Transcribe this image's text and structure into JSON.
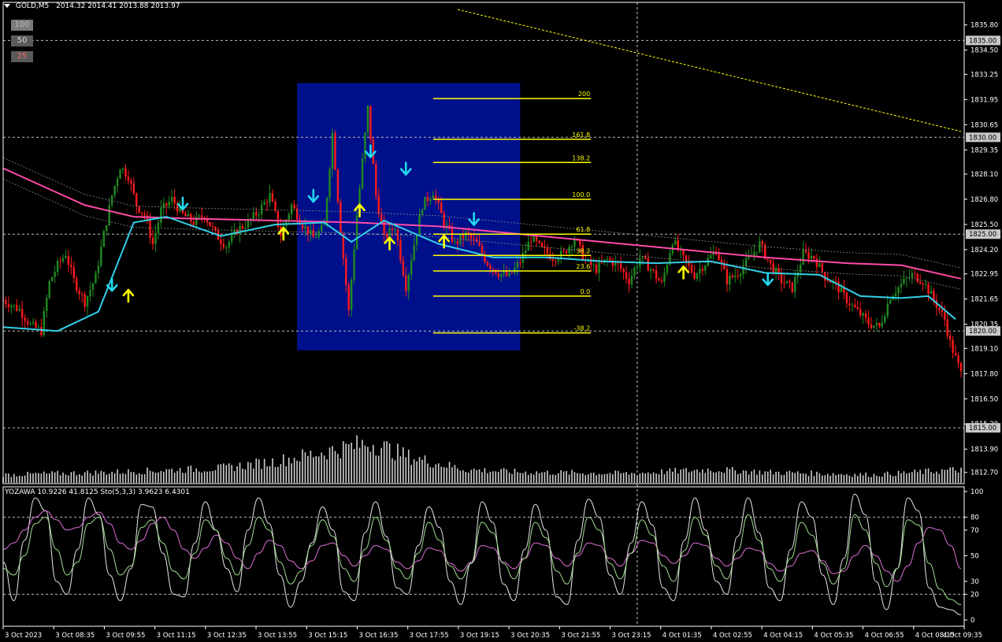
{
  "header": {
    "symbol": "GOLD,M5",
    "ohlc": "2014.32 2014.41 2013.88 2013.97"
  },
  "timeframe_buttons": [
    {
      "label": "100",
      "color": "#bdbdbd",
      "bg": "#7a7a7a"
    },
    {
      "label": "50",
      "color": "#d9d9d9",
      "bg": "#5a5a5a"
    },
    {
      "label": "25",
      "color": "#ff6a6a",
      "bg": "#5a5a5a"
    }
  ],
  "indicator_header": {
    "text": "YOZAWA 10.9226 41.8125  Sto(5,3,3) 3.9623 6.4301"
  },
  "colors": {
    "background": "#000000",
    "bull_bar": "#1f8a1f",
    "bear_bar": "#ff1a1a",
    "ma_fast": "#33d0e8",
    "ma_slow": "#ff4aa8",
    "fib_line": "#ffff00",
    "fib_box": "#00108a",
    "arrow_up": "#ffff00",
    "arrow_down": "#22d8f0",
    "volume": "#d0d0d0",
    "stoch_main": "#e8e8e8",
    "stoch_pink": "#e070d8",
    "stoch_green": "#a0e090",
    "axis": "#ffffff",
    "level_highlight_bg": "#c8c8c8"
  },
  "chart_data": [
    {
      "type": "candlestick",
      "price_axis_ticks": [
        "1835.80",
        "1834.50",
        "1833.25",
        "1831.95",
        "1830.65",
        "1829.35",
        "1828.10",
        "1826.80",
        "1825.50",
        "1824.20",
        "1822.95",
        "1821.65",
        "1820.35",
        "1819.10",
        "1817.80",
        "1816.50",
        "1815.20",
        "1813.90",
        "1812.70"
      ],
      "highlighted_levels": [
        "1835.00",
        "1830.00",
        "1825.00",
        "1820.00",
        "1815.00"
      ],
      "time_axis_ticks": [
        "3 Oct 2023",
        "3 Oct 08:35",
        "3 Oct 09:55",
        "3 Oct 11:15",
        "3 Oct 12:35",
        "3 Oct 13:55",
        "3 Oct 15:15",
        "3 Oct 16:35",
        "3 Oct 17:55",
        "3 Oct 19:15",
        "3 Oct 20:35",
        "3 Oct 21:55",
        "3 Oct 23:15",
        "4 Oct 01:35",
        "4 Oct 02:55",
        "4 Oct 04:15",
        "4 Oct 05:35",
        "4 Oct 06:55",
        "4 Oct 08:15",
        "4 Oct 09:35"
      ],
      "ylim": [
        1812.2,
        1836.6
      ],
      "close_path": [
        [
          0,
          1821.6
        ],
        [
          6,
          1821.1
        ],
        [
          10,
          1820.3
        ],
        [
          14,
          1820.0
        ],
        [
          17,
          1822.5
        ],
        [
          20,
          1823.4
        ],
        [
          23,
          1824.0
        ],
        [
          26,
          1822.6
        ],
        [
          30,
          1821.5
        ],
        [
          34,
          1822.8
        ],
        [
          37,
          1825.0
        ],
        [
          40,
          1827.0
        ],
        [
          43,
          1828.5
        ],
        [
          46,
          1828.0
        ],
        [
          49,
          1826.5
        ],
        [
          52,
          1826.0
        ],
        [
          55,
          1824.5
        ],
        [
          58,
          1826.2
        ],
        [
          62,
          1826.8
        ],
        [
          66,
          1826.0
        ],
        [
          70,
          1825.6
        ],
        [
          74,
          1826.0
        ],
        [
          78,
          1825.0
        ],
        [
          82,
          1824.4
        ],
        [
          86,
          1825.2
        ],
        [
          90,
          1825.6
        ],
        [
          94,
          1826.2
        ],
        [
          98,
          1827.0
        ],
        [
          102,
          1825.0
        ],
        [
          106,
          1826.5
        ],
        [
          110,
          1825.5
        ],
        [
          114,
          1824.8
        ],
        [
          118,
          1825.4
        ],
        [
          121,
          1830.2
        ],
        [
          124,
          1825.2
        ],
        [
          127,
          1821.0
        ],
        [
          130,
          1826.0
        ],
        [
          134,
          1831.5
        ],
        [
          137,
          1827.0
        ],
        [
          140,
          1824.8
        ],
        [
          144,
          1825.4
        ],
        [
          148,
          1822.3
        ],
        [
          151,
          1824.5
        ],
        [
          154,
          1826.5
        ],
        [
          158,
          1827.2
        ],
        [
          162,
          1825.6
        ],
        [
          166,
          1824.5
        ],
        [
          170,
          1825.0
        ],
        [
          174,
          1824.5
        ],
        [
          178,
          1823.5
        ],
        [
          182,
          1823.0
        ],
        [
          186,
          1822.8
        ],
        [
          190,
          1823.6
        ],
        [
          194,
          1824.8
        ],
        [
          198,
          1824.2
        ],
        [
          202,
          1823.8
        ],
        [
          206,
          1824.0
        ],
        [
          210,
          1824.8
        ],
        [
          214,
          1823.6
        ],
        [
          218,
          1823.2
        ],
        [
          222,
          1823.7
        ],
        [
          226,
          1823.4
        ],
        [
          230,
          1822.6
        ],
        [
          234,
          1823.8
        ],
        [
          238,
          1823.2
        ],
        [
          242,
          1822.4
        ],
        [
          246,
          1824.7
        ],
        [
          250,
          1823.7
        ],
        [
          254,
          1822.9
        ],
        [
          258,
          1823.5
        ],
        [
          262,
          1824.2
        ],
        [
          266,
          1822.6
        ],
        [
          270,
          1823.0
        ],
        [
          274,
          1823.7
        ],
        [
          278,
          1824.5
        ],
        [
          282,
          1823.4
        ],
        [
          286,
          1822.6
        ],
        [
          290,
          1822.2
        ],
        [
          294,
          1824.0
        ],
        [
          298,
          1823.8
        ],
        [
          302,
          1822.8
        ],
        [
          306,
          1822.4
        ],
        [
          310,
          1821.6
        ],
        [
          314,
          1821.0
        ],
        [
          318,
          1820.4
        ],
        [
          322,
          1820.2
        ],
        [
          326,
          1821.8
        ],
        [
          330,
          1822.4
        ],
        [
          334,
          1822.9
        ],
        [
          338,
          1822.6
        ],
        [
          342,
          1821.6
        ],
        [
          346,
          1820.6
        ],
        [
          348,
          1819.4
        ],
        [
          350,
          1818.6
        ],
        [
          352,
          1817.8
        ]
      ],
      "x_domain": [
        0,
        352
      ],
      "ma_fast_path": [
        [
          0,
          1820.2
        ],
        [
          20,
          1820.0
        ],
        [
          35,
          1821.0
        ],
        [
          48,
          1825.6
        ],
        [
          60,
          1825.9
        ],
        [
          80,
          1824.9
        ],
        [
          100,
          1825.5
        ],
        [
          118,
          1825.6
        ],
        [
          128,
          1824.6
        ],
        [
          140,
          1825.7
        ],
        [
          160,
          1824.5
        ],
        [
          180,
          1823.8
        ],
        [
          200,
          1823.8
        ],
        [
          220,
          1823.6
        ],
        [
          240,
          1823.5
        ],
        [
          260,
          1823.6
        ],
        [
          280,
          1823.0
        ],
        [
          300,
          1822.9
        ],
        [
          315,
          1821.8
        ],
        [
          330,
          1821.7
        ],
        [
          340,
          1821.8
        ],
        [
          350,
          1820.6
        ]
      ],
      "ma_slow_path": [
        [
          0,
          1828.4
        ],
        [
          30,
          1826.5
        ],
        [
          48,
          1825.9
        ],
        [
          70,
          1825.8
        ],
        [
          100,
          1825.7
        ],
        [
          130,
          1825.6
        ],
        [
          160,
          1825.4
        ],
        [
          190,
          1825.0
        ],
        [
          220,
          1824.6
        ],
        [
          250,
          1824.2
        ],
        [
          280,
          1823.8
        ],
        [
          310,
          1823.5
        ],
        [
          330,
          1823.4
        ],
        [
          352,
          1822.7
        ]
      ],
      "trend_line": [
        [
          167,
          1836.6
        ],
        [
          352,
          1830.3
        ]
      ],
      "fib_box": {
        "x0": 108,
        "x1": 190,
        "y0": 1832.8,
        "y1": 1819.0
      },
      "fib_levels": [
        {
          "label": "200",
          "price": 1832.0
        },
        {
          "label": "161.8",
          "price": 1829.9
        },
        {
          "label": "138.2",
          "price": 1828.7
        },
        {
          "label": "100.0",
          "price": 1826.8
        },
        {
          "label": "61.8",
          "price": 1825.0
        },
        {
          "label": "38.2",
          "price": 1823.9
        },
        {
          "label": "23.6",
          "price": 1823.1
        },
        {
          "label": "0.0",
          "price": 1821.8
        },
        {
          "label": "-38.2",
          "price": 1819.9
        }
      ],
      "fib_x_range": [
        158,
        216
      ],
      "arrows_up": [
        [
          46,
          1821.8
        ],
        [
          103,
          1825.0
        ],
        [
          131,
          1826.2
        ],
        [
          142,
          1824.5
        ],
        [
          162,
          1824.6
        ],
        [
          250,
          1823.0
        ]
      ],
      "arrows_down": [
        [
          40,
          1822.4
        ],
        [
          66,
          1826.6
        ],
        [
          114,
          1827.0
        ],
        [
          135,
          1829.3
        ],
        [
          148,
          1828.4
        ],
        [
          173,
          1825.8
        ],
        [
          281,
          1822.7
        ]
      ],
      "cursor_x": 233,
      "volume_shape": [
        [
          0,
          12
        ],
        [
          40,
          16
        ],
        [
          80,
          22
        ],
        [
          100,
          32
        ],
        [
          120,
          48
        ],
        [
          135,
          60
        ],
        [
          138,
          56
        ],
        [
          150,
          38
        ],
        [
          170,
          20
        ],
        [
          190,
          16
        ],
        [
          230,
          14
        ],
        [
          260,
          20
        ],
        [
          280,
          16
        ],
        [
          320,
          12
        ],
        [
          352,
          20
        ]
      ]
    },
    {
      "type": "line",
      "name": "Sto(5,3,3)",
      "ylim": [
        0,
        100
      ],
      "y_ticks": [
        "100",
        "80",
        "70",
        "50",
        "30",
        "20",
        "0"
      ],
      "dashed_levels": [
        80,
        20
      ],
      "series": [
        {
          "color_key": "stoch_main",
          "values": [
            45,
            15,
            62,
            95,
            85,
            30,
            20,
            55,
            95,
            82,
            35,
            15,
            40,
            90,
            88,
            52,
            20,
            18,
            60,
            92,
            70,
            40,
            22,
            70,
            95,
            75,
            35,
            10,
            30,
            60,
            88,
            70,
            22,
            15,
            68,
            92,
            65,
            25,
            20,
            58,
            88,
            72,
            30,
            12,
            45,
            92,
            76,
            28,
            15,
            55,
            90,
            70,
            18,
            12,
            62,
            94,
            80,
            35,
            20,
            60,
            92,
            74,
            25,
            15,
            62,
            95,
            70,
            30,
            20,
            65,
            95,
            68,
            25,
            15,
            55,
            92,
            80,
            35,
            12,
            48,
            98,
            82,
            30,
            8,
            40,
            95,
            85,
            25,
            10,
            8,
            4
          ]
        },
        {
          "color_key": "stoch_pink",
          "values": [
            55,
            60,
            70,
            80,
            85,
            78,
            70,
            72,
            80,
            84,
            75,
            60,
            55,
            62,
            75,
            80,
            70,
            55,
            48,
            56,
            66,
            60,
            48,
            40,
            52,
            62,
            58,
            46,
            40,
            46,
            58,
            60,
            50,
            42,
            50,
            58,
            55,
            45,
            40,
            46,
            56,
            54,
            44,
            38,
            45,
            58,
            56,
            45,
            40,
            48,
            60,
            58,
            48,
            42,
            50,
            60,
            58,
            48,
            42,
            52,
            62,
            60,
            50,
            44,
            50,
            60,
            58,
            48,
            42,
            48,
            56,
            54,
            44,
            38,
            42,
            52,
            54,
            46,
            36,
            38,
            50,
            58,
            50,
            38,
            30,
            42,
            60,
            72,
            70,
            58,
            40
          ]
        },
        {
          "color_key": "stoch_green",
          "values": [
            40,
            35,
            50,
            75,
            80,
            55,
            35,
            45,
            75,
            80,
            55,
            35,
            42,
            72,
            78,
            60,
            38,
            32,
            52,
            78,
            70,
            48,
            35,
            58,
            80,
            70,
            45,
            28,
            38,
            58,
            78,
            65,
            40,
            30,
            55,
            80,
            62,
            40,
            32,
            52,
            76,
            62,
            42,
            32,
            44,
            76,
            68,
            44,
            32,
            48,
            76,
            64,
            38,
            28,
            52,
            80,
            70,
            44,
            32,
            52,
            78,
            66,
            42,
            30,
            54,
            80,
            66,
            42,
            32,
            54,
            82,
            62,
            40,
            30,
            48,
            76,
            66,
            44,
            28,
            40,
            82,
            70,
            44,
            26,
            40,
            78,
            74,
            44,
            24,
            16,
            12
          ]
        }
      ]
    }
  ]
}
